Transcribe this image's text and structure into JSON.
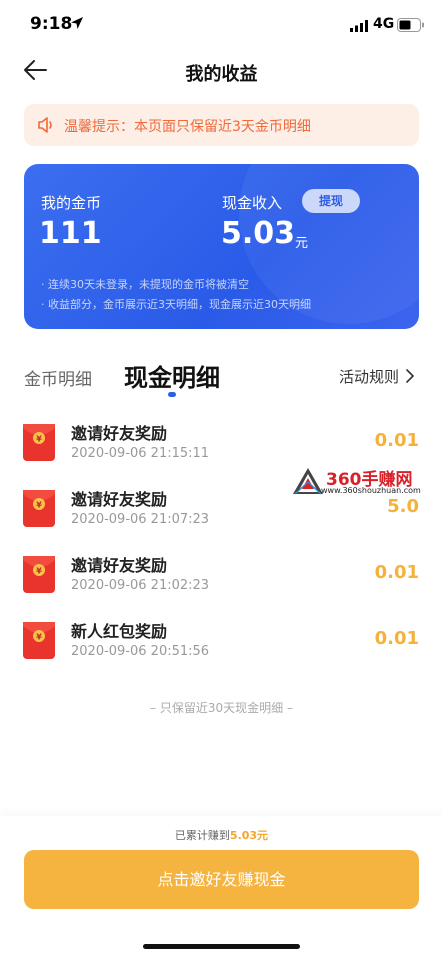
{
  "status_bar": {
    "time": "9:18",
    "network": "4G"
  },
  "nav": {
    "title": "我的收益"
  },
  "notice": {
    "text": "温馨提示：本页面只保留近3天金币明细"
  },
  "balance_card": {
    "coin_label": "我的金币",
    "coin_value": "111",
    "cash_label": "现金收入",
    "withdraw_label": "提现",
    "cash_value": "5.03",
    "cash_unit": "元",
    "note_1": "· 连续30天未登录，未提现的金币将被清空",
    "note_2": "· 收益部分，金币展示近3天明细，现金展示近30天明细"
  },
  "tabs": {
    "coin_tab": "金币明细",
    "cash_tab": "现金明细",
    "rules_link": "活动规则"
  },
  "records": [
    {
      "title": "邀请好友奖励",
      "time": "2020-09-06 21:15:11",
      "amount": "0.01"
    },
    {
      "title": "邀请好友奖励",
      "time": "2020-09-06 21:07:23",
      "amount": "5.0"
    },
    {
      "title": "邀请好友奖励",
      "time": "2020-09-06 21:02:23",
      "amount": "0.01"
    },
    {
      "title": "新人红包奖励",
      "time": "2020-09-06 20:51:56",
      "amount": "0.01"
    }
  ],
  "list_footer": "– 只保留近30天现金明细 –",
  "watermark": {
    "main": "360手赚网",
    "sub": "www.360shouzhuan.com"
  },
  "bottom": {
    "total_prefix": "已累计赚到",
    "total_amount": "5.03元",
    "invite_button": "点击邀好友赚现金"
  },
  "colors": {
    "accent_blue": "#2f5fe9",
    "amount_gold": "#f4b23a",
    "notice_orange": "#f06a3a",
    "button_gold": "#f5b43f"
  }
}
